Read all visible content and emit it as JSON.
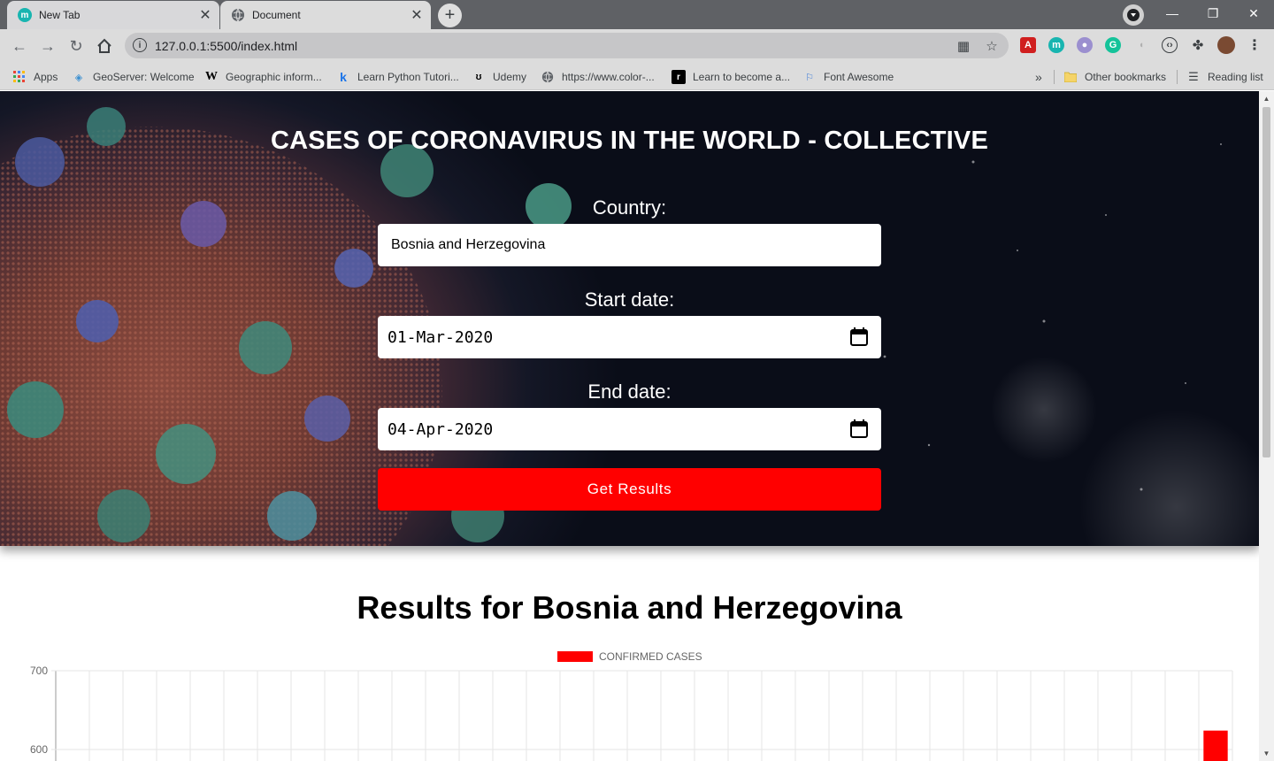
{
  "browser": {
    "tabs": [
      {
        "title": "New Tab",
        "active": false
      },
      {
        "title": "Document",
        "active": true
      }
    ],
    "url": "127.0.0.1:5500/index.html",
    "bookmarks": [
      {
        "label": "Apps",
        "icon": "apps-grid-icon"
      },
      {
        "label": "GeoServer: Welcome",
        "icon": "geoserver-icon"
      },
      {
        "label": "Geographic inform...",
        "icon": "wikipedia-icon"
      },
      {
        "label": "Learn Python Tutori...",
        "icon": "k-icon"
      },
      {
        "label": "Udemy",
        "icon": "udemy-icon"
      },
      {
        "label": "https://www.color-...",
        "icon": "globe-icon"
      },
      {
        "label": "Learn to become a...",
        "icon": "r-icon"
      },
      {
        "label": "Font Awesome",
        "icon": "flag-icon"
      }
    ],
    "other_bookmarks": "Other bookmarks",
    "reading_list": "Reading list"
  },
  "hero": {
    "title": "CASES OF CORONAVIRUS IN THE WORLD - COLLECTIVE",
    "country_label": "Country:",
    "country_value": "Bosnia and Herzegovina",
    "start_label": "Start date:",
    "start_value": "01-Mar-2020",
    "end_label": "End date:",
    "end_value": "04-Apr-2020",
    "button_label": "Get Results"
  },
  "results": {
    "title": "Results for Bosnia and Herzegovina"
  },
  "chart_data": {
    "type": "bar",
    "legend": [
      {
        "label": "CONFIRMED CASES",
        "color": "#ff0000"
      }
    ],
    "legend_position": "top",
    "y_ticks": [
      700,
      600
    ],
    "ylim_visible": [
      591,
      700
    ],
    "grid": true,
    "category_count": 35,
    "series": [
      {
        "name": "CONFIRMED CASES",
        "color": "#ff0000",
        "values": [
          null,
          null,
          null,
          null,
          null,
          null,
          null,
          null,
          null,
          null,
          null,
          null,
          null,
          null,
          null,
          null,
          null,
          null,
          null,
          null,
          null,
          null,
          null,
          null,
          null,
          null,
          null,
          null,
          null,
          null,
          null,
          null,
          null,
          null,
          624
        ]
      }
    ]
  }
}
